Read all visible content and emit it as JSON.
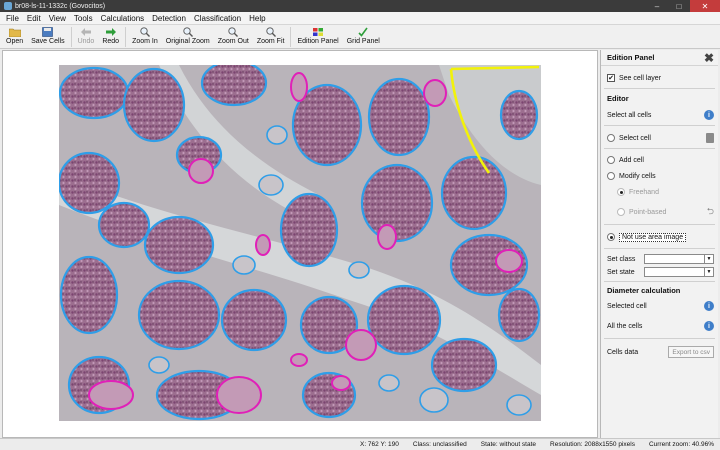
{
  "window": {
    "title": "br08-ls-11-1332c (Govocitos)",
    "minimize": "–",
    "maximize": "□",
    "close": "✕"
  },
  "menu": [
    "File",
    "Edit",
    "View",
    "Tools",
    "Calculations",
    "Detection",
    "Classification",
    "Help"
  ],
  "toolbar": {
    "open": "Open",
    "save_cells": "Save Cells",
    "undo": "Undo",
    "redo": "Redo",
    "zoom_in": "Zoom In",
    "original_zoom": "Original Zoom",
    "zoom_out": "Zoom Out",
    "zoom_fit": "Zoom Fit",
    "edition_panel": "Edition Panel",
    "grid_panel": "Grid Panel"
  },
  "panel": {
    "title": "Edition Panel",
    "see_cell_layer": "See cell layer",
    "editor_heading": "Editor",
    "select_all_cells": "Select all cells",
    "select_cell": "Select cell",
    "add_cell": "Add cell",
    "modify_cells": "Modify cells",
    "freehand": "Freehand",
    "point_based": "Point-based",
    "not_use_area_image": "Not use area image",
    "set_class": "Set class",
    "set_state": "Set state",
    "diameter_heading": "Diameter calculation",
    "selected_cell": "Selected cell",
    "all_the_cells": "All the cells",
    "cells_data": "Cells data",
    "export_csv": "Export to csv"
  },
  "status": {
    "coords": "X: 762 Y: 190",
    "class": "Class: unclassified",
    "state": "State: without state",
    "resolution": "Resolution: 2088x1550 pixels",
    "zoom": "Current zoom: 40.96%"
  },
  "colors": {
    "outline_blue": "#2f9ee8",
    "outline_magenta": "#e020b8",
    "outline_yellow": "#f2f20a",
    "tissue": "#b7b2b7"
  }
}
